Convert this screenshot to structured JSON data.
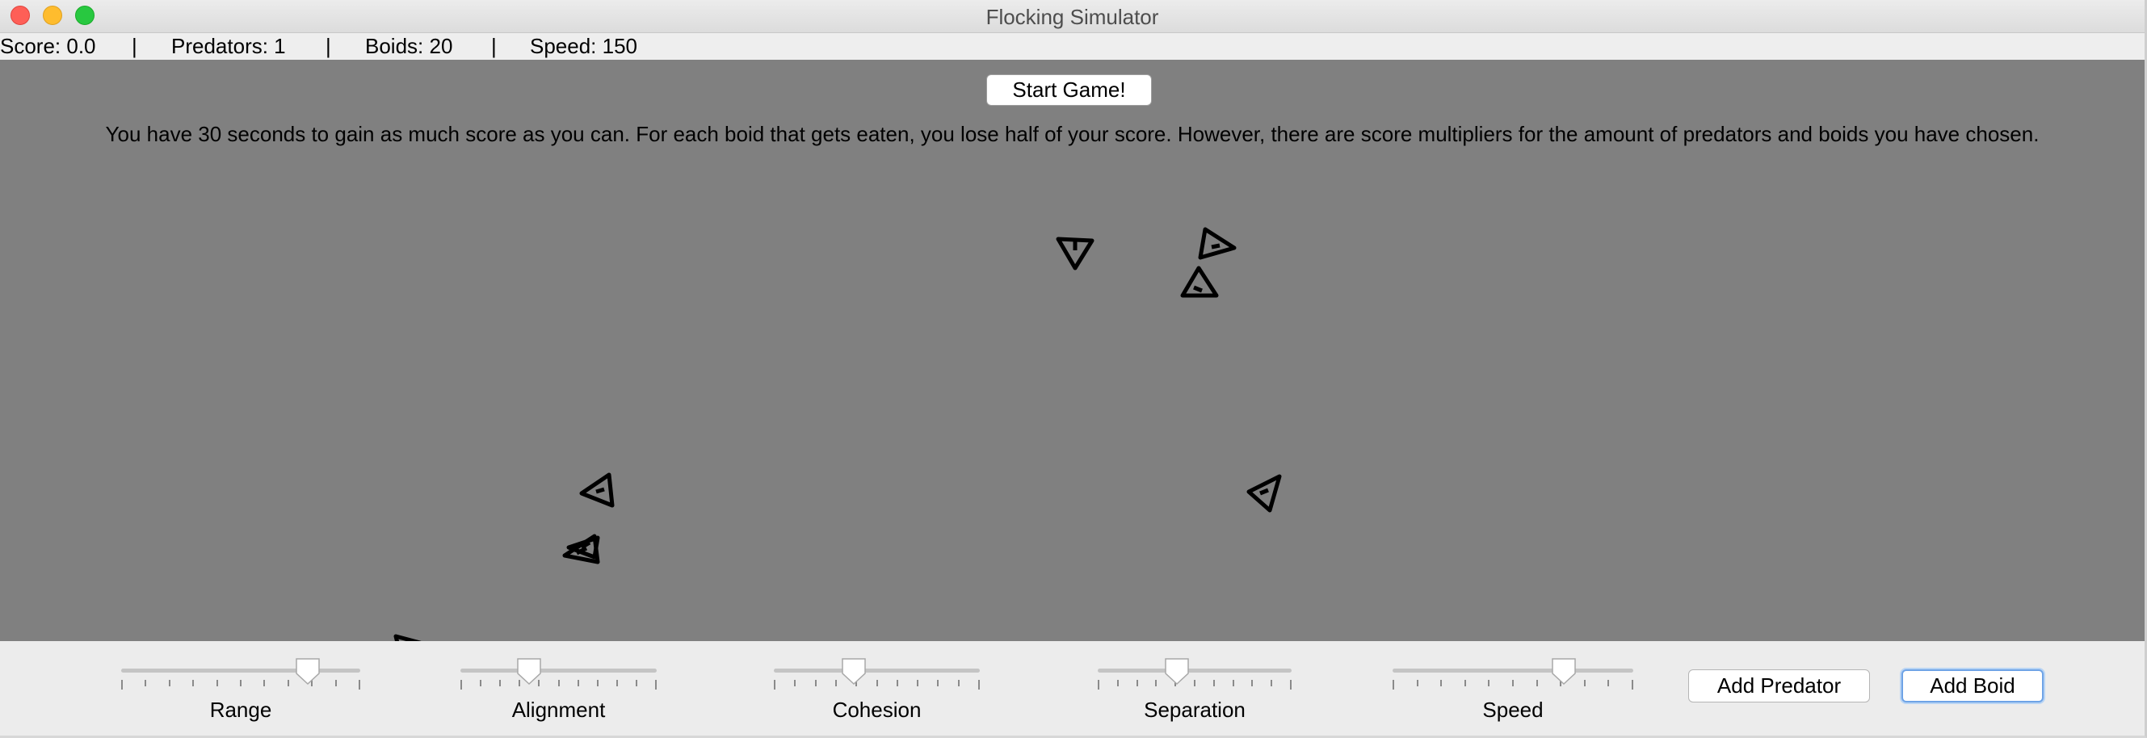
{
  "window": {
    "title": "Flocking Simulator"
  },
  "status": {
    "score": "Score: 0.0",
    "separator": "|",
    "predators": "Predators: 1",
    "boids": "Boids: 20",
    "speed": "Speed: 150"
  },
  "game": {
    "start_label": "Start Game!",
    "instructions": "You have 30 seconds to gain as much score as you can. For each boid that gets eaten, you lose half of your score.  However, there are score multipliers for the amount of predators and boids you have chosen."
  },
  "sliders": [
    {
      "label": "Range",
      "value": 0.78
    },
    {
      "label": "Alignment",
      "value": 0.35
    },
    {
      "label": "Cohesion",
      "value": 0.39
    },
    {
      "label": "Separation",
      "value": 0.41
    },
    {
      "label": "Speed",
      "value": 0.71
    }
  ],
  "buttons": {
    "add_predator": "Add Predator",
    "add_boid": "Add Boid"
  },
  "colors": {
    "canvas": "#808080",
    "boid_stroke": "#000000",
    "focus_ring": "#6ea3e6"
  },
  "icons": {
    "boid": "triangle-icon"
  }
}
